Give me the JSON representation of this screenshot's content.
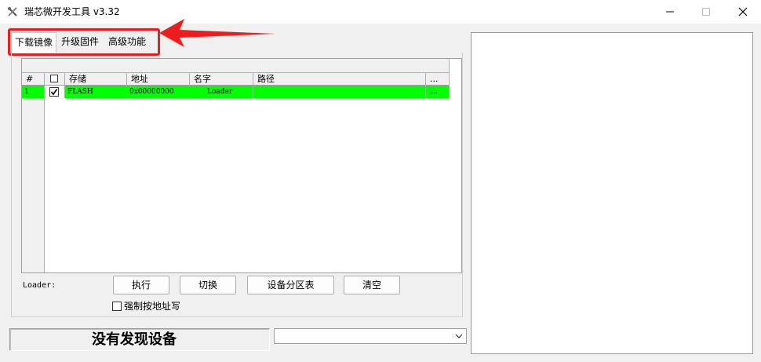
{
  "window": {
    "title": "瑞芯微开发工具 v3.32"
  },
  "tabs": [
    {
      "label": "下载镜像"
    },
    {
      "label": "升级固件"
    },
    {
      "label": "高级功能"
    }
  ],
  "grid": {
    "columns": {
      "index": "#",
      "storage": "存储",
      "address": "地址",
      "name": "名字",
      "path": "路径",
      "more": "..."
    },
    "rows": [
      {
        "index": "1",
        "checked": true,
        "storage": "FLASH",
        "address": "0x00000000",
        "name": "Loader",
        "path": "",
        "more": "..."
      }
    ]
  },
  "actions": {
    "loader_label": "Loader:",
    "execute": "执行",
    "switch": "切换",
    "partition_table": "设备分区表",
    "clear": "清空",
    "force_write_label": "强制按地址写"
  },
  "status": {
    "text": "没有发现设备"
  },
  "colors": {
    "row_highlight": "#00ff00",
    "annotation_red": "#ee1c1c"
  }
}
